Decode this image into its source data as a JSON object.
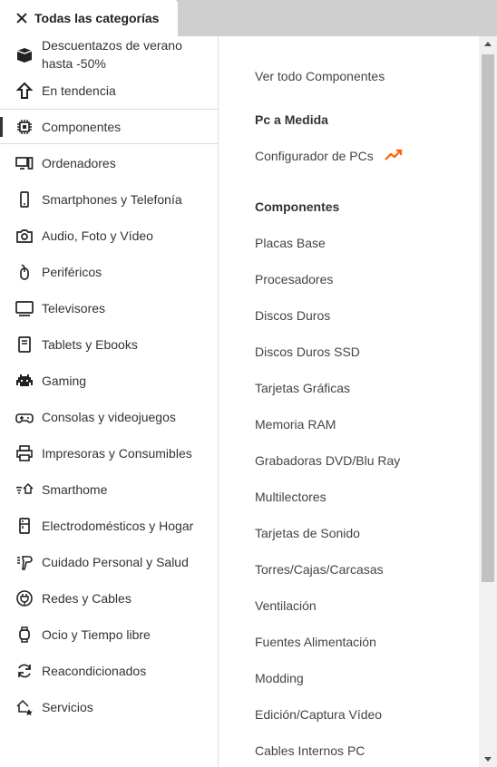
{
  "header": {
    "close_icon": "close-icon",
    "title": "Todas las categorías"
  },
  "left": {
    "promo": {
      "label_line1": "Descuentazos de verano",
      "label_line2": "hasta -50%"
    },
    "trending": {
      "label": "En tendencia"
    },
    "categories": [
      {
        "label": "Componentes",
        "icon": "chip-icon"
      },
      {
        "label": "Ordenadores",
        "icon": "desktop-icon"
      },
      {
        "label": "Smartphones y Telefonía",
        "icon": "smartphone-icon"
      },
      {
        "label": "Audio, Foto y Vídeo",
        "icon": "camera-icon"
      },
      {
        "label": "Periféricos",
        "icon": "mouse-icon"
      },
      {
        "label": "Televisores",
        "icon": "tv-icon"
      },
      {
        "label": "Tablets y Ebooks",
        "icon": "tablet-icon"
      },
      {
        "label": "Gaming",
        "icon": "gaming-icon"
      },
      {
        "label": "Consolas y videojuegos",
        "icon": "gamepad-icon"
      },
      {
        "label": "Impresoras y Consumibles",
        "icon": "printer-icon"
      },
      {
        "label": "Smarthome",
        "icon": "smarthome-icon"
      },
      {
        "label": "Electrodomésticos y Hogar",
        "icon": "fridge-icon"
      },
      {
        "label": "Cuidado Personal y Salud",
        "icon": "hairdryer-icon"
      },
      {
        "label": "Redes y Cables",
        "icon": "plug-icon"
      },
      {
        "label": "Ocio y Tiempo libre",
        "icon": "watch-icon"
      },
      {
        "label": "Reacondicionados",
        "icon": "refresh-icon"
      },
      {
        "label": "Servicios",
        "icon": "services-icon"
      }
    ]
  },
  "right": {
    "view_all": "Ver todo Componentes",
    "section1_title": "Pc a Medida",
    "configurator": "Configurador de PCs",
    "section2_title": "Componentes",
    "items": [
      "Placas Base",
      "Procesadores",
      "Discos Duros",
      "Discos Duros SSD",
      "Tarjetas Gráficas",
      "Memoria RAM",
      "Grabadoras DVD/Blu Ray",
      "Multilectores",
      "Tarjetas de Sonido",
      "Torres/Cajas/Carcasas",
      "Ventilación",
      "Fuentes Alimentación",
      "Modding",
      "Edición/Captura Vídeo",
      "Cables Internos PC"
    ]
  },
  "colors": {
    "accent_orange": "#ff6000",
    "active_border": "#333333"
  }
}
